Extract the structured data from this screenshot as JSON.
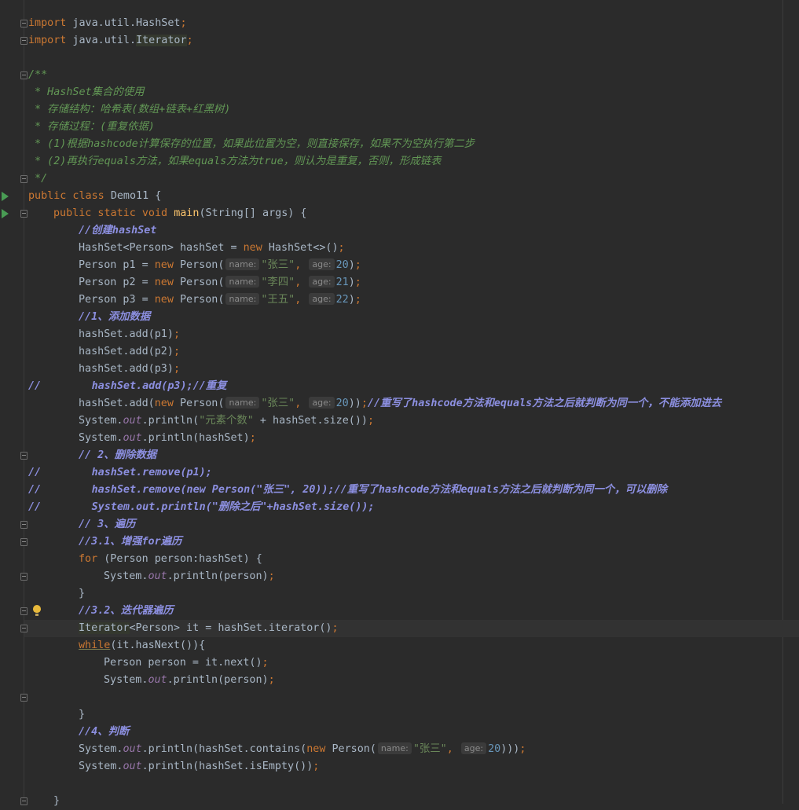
{
  "editor": {
    "language": "java",
    "file_class": "Demo11",
    "lines": [
      {
        "tokens": [
          {
            "t": "import",
            "c": "kw"
          },
          {
            "t": " java.util.HashSet",
            "c": ""
          },
          {
            "t": ";",
            "c": "kw"
          }
        ]
      },
      {
        "tokens": [
          {
            "t": "import",
            "c": "kw"
          },
          {
            "t": " java.util.",
            "c": ""
          },
          {
            "t": "Iterator",
            "c": "import-box"
          },
          {
            "t": ";",
            "c": "kw"
          }
        ]
      },
      {
        "tokens": []
      },
      {
        "tokens": [
          {
            "t": "/**",
            "c": "doc"
          }
        ]
      },
      {
        "tokens": [
          {
            "t": " * HashSet集合的使用",
            "c": "doc"
          }
        ]
      },
      {
        "tokens": [
          {
            "t": " * 存储结构：哈希表(数组+链表+红黑树)",
            "c": "doc"
          }
        ]
      },
      {
        "tokens": [
          {
            "t": " * 存储过程：(重复依据)",
            "c": "doc"
          }
        ]
      },
      {
        "tokens": [
          {
            "t": " * (1)根据hashcode计算保存的位置，如果此位置为空，则直接保存，如果不为空执行第二步",
            "c": "doc"
          }
        ]
      },
      {
        "tokens": [
          {
            "t": " * (2)再执行equals方法，如果equals方法为true，则认为是重复，否则，形成链表",
            "c": "doc"
          }
        ]
      },
      {
        "tokens": [
          {
            "t": " */",
            "c": "doc"
          }
        ]
      },
      {
        "tokens": [
          {
            "t": "public class ",
            "c": "kw"
          },
          {
            "t": "Demo11 {",
            "c": ""
          }
        ]
      },
      {
        "indent": 1,
        "tokens": [
          {
            "t": "public static void ",
            "c": "kw"
          },
          {
            "t": "main",
            "c": "fn"
          },
          {
            "t": "(String[] args) {",
            "c": ""
          }
        ]
      },
      {
        "indent": 2,
        "tokens": [
          {
            "t": "//创建hashSet",
            "c": "cm"
          }
        ]
      },
      {
        "indent": 2,
        "tokens": [
          {
            "t": "HashSet<Person> hashSet = ",
            "c": ""
          },
          {
            "t": "new ",
            "c": "kw"
          },
          {
            "t": "HashSet<>()",
            "c": ""
          },
          {
            "t": ";",
            "c": "kw"
          }
        ]
      },
      {
        "indent": 2,
        "tokens": [
          {
            "t": "Person p1 = ",
            "c": ""
          },
          {
            "t": "new ",
            "c": "kw"
          },
          {
            "t": "Person(",
            "c": ""
          },
          {
            "t": "name:",
            "c": "hint"
          },
          {
            "t": "\"张三\"",
            "c": "str"
          },
          {
            "t": ", ",
            "c": "kw"
          },
          {
            "t": "age:",
            "c": "hint"
          },
          {
            "t": "20",
            "c": "num"
          },
          {
            "t": ")",
            "c": ""
          },
          {
            "t": ";",
            "c": "kw"
          }
        ]
      },
      {
        "indent": 2,
        "tokens": [
          {
            "t": "Person p2 = ",
            "c": ""
          },
          {
            "t": "new ",
            "c": "kw"
          },
          {
            "t": "Person(",
            "c": ""
          },
          {
            "t": "name:",
            "c": "hint"
          },
          {
            "t": "\"李四\"",
            "c": "str"
          },
          {
            "t": ", ",
            "c": "kw"
          },
          {
            "t": "age:",
            "c": "hint"
          },
          {
            "t": "21",
            "c": "num"
          },
          {
            "t": ")",
            "c": ""
          },
          {
            "t": ";",
            "c": "kw"
          }
        ]
      },
      {
        "indent": 2,
        "tokens": [
          {
            "t": "Person p3 = ",
            "c": ""
          },
          {
            "t": "new ",
            "c": "kw"
          },
          {
            "t": "Person(",
            "c": ""
          },
          {
            "t": "name:",
            "c": "hint"
          },
          {
            "t": "\"王五\"",
            "c": "str"
          },
          {
            "t": ", ",
            "c": "kw"
          },
          {
            "t": "age:",
            "c": "hint"
          },
          {
            "t": "22",
            "c": "num"
          },
          {
            "t": ")",
            "c": ""
          },
          {
            "t": ";",
            "c": "kw"
          }
        ]
      },
      {
        "indent": 2,
        "tokens": [
          {
            "t": "//1、添加数据",
            "c": "cm"
          }
        ]
      },
      {
        "indent": 2,
        "tokens": [
          {
            "t": "hashSet.add(p1)",
            "c": ""
          },
          {
            "t": ";",
            "c": "kw"
          }
        ]
      },
      {
        "indent": 2,
        "tokens": [
          {
            "t": "hashSet.add(p2)",
            "c": ""
          },
          {
            "t": ";",
            "c": "kw"
          }
        ]
      },
      {
        "indent": 2,
        "tokens": [
          {
            "t": "hashSet.add(p3)",
            "c": ""
          },
          {
            "t": ";",
            "c": "kw"
          }
        ]
      },
      {
        "tokens": [
          {
            "t": "//        hashSet.add(p3);//重复",
            "c": "cm"
          }
        ]
      },
      {
        "indent": 2,
        "tokens": [
          {
            "t": "hashSet.add(",
            "c": ""
          },
          {
            "t": "new ",
            "c": "kw"
          },
          {
            "t": "Person(",
            "c": ""
          },
          {
            "t": "name:",
            "c": "hint"
          },
          {
            "t": "\"张三\"",
            "c": "str"
          },
          {
            "t": ", ",
            "c": "kw"
          },
          {
            "t": "age:",
            "c": "hint"
          },
          {
            "t": "20",
            "c": "num"
          },
          {
            "t": "))",
            "c": ""
          },
          {
            "t": ";",
            "c": "kw"
          },
          {
            "t": "//重写了hashcode方法和equals方法之后就判断为同一个，不能添加进去",
            "c": "cm"
          }
        ]
      },
      {
        "indent": 2,
        "tokens": [
          {
            "t": "System.",
            "c": ""
          },
          {
            "t": "out",
            "c": "fld"
          },
          {
            "t": ".println(",
            "c": ""
          },
          {
            "t": "\"元素个数\"",
            "c": "str"
          },
          {
            "t": " + hashSet.size())",
            "c": ""
          },
          {
            "t": ";",
            "c": "kw"
          }
        ]
      },
      {
        "indent": 2,
        "tokens": [
          {
            "t": "System.",
            "c": ""
          },
          {
            "t": "out",
            "c": "fld"
          },
          {
            "t": ".println(hashSet)",
            "c": ""
          },
          {
            "t": ";",
            "c": "kw"
          }
        ]
      },
      {
        "indent": 2,
        "tokens": [
          {
            "t": "// 2、删除数据",
            "c": "cm"
          }
        ]
      },
      {
        "tokens": [
          {
            "t": "//        hashSet.remove(p1);",
            "c": "cm"
          }
        ]
      },
      {
        "tokens": [
          {
            "t": "//        hashSet.remove(new Person(\"张三\", 20));//重写了hashcode方法和equals方法之后就判断为同一个，可以删除",
            "c": "cm"
          }
        ]
      },
      {
        "tokens": [
          {
            "t": "//        System.out.println(\"删除之后\"+hashSet.size());",
            "c": "cm"
          }
        ]
      },
      {
        "indent": 2,
        "tokens": [
          {
            "t": "// 3、遍历",
            "c": "cm"
          }
        ]
      },
      {
        "indent": 2,
        "tokens": [
          {
            "t": "//3.1、增强for遍历",
            "c": "cm"
          }
        ]
      },
      {
        "indent": 2,
        "tokens": [
          {
            "t": "for ",
            "c": "kw"
          },
          {
            "t": "(Person person:hashSet) {",
            "c": ""
          }
        ]
      },
      {
        "indent": 3,
        "tokens": [
          {
            "t": "System.",
            "c": ""
          },
          {
            "t": "out",
            "c": "fld"
          },
          {
            "t": ".println(person)",
            "c": ""
          },
          {
            "t": ";",
            "c": "kw"
          }
        ]
      },
      {
        "indent": 2,
        "tokens": [
          {
            "t": "}",
            "c": ""
          }
        ]
      },
      {
        "indent": 2,
        "tokens": [
          {
            "t": "//3.2、迭代器遍历",
            "c": "cm"
          }
        ]
      },
      {
        "indent": 2,
        "tokens": [
          {
            "t": "Iterator",
            "c": "import-box"
          },
          {
            "t": "<Person> it = hashSet.iterator()",
            "c": ""
          },
          {
            "t": ";",
            "c": "kw"
          }
        ]
      },
      {
        "indent": 2,
        "tokens": [
          {
            "t": "while",
            "c": "kw ulw"
          },
          {
            "t": "(it.hasNext()){",
            "c": ""
          }
        ]
      },
      {
        "indent": 3,
        "tokens": [
          {
            "t": "Person person = it.next()",
            "c": ""
          },
          {
            "t": ";",
            "c": "kw"
          }
        ]
      },
      {
        "indent": 3,
        "tokens": [
          {
            "t": "System.",
            "c": ""
          },
          {
            "t": "out",
            "c": "fld"
          },
          {
            "t": ".println(person)",
            "c": ""
          },
          {
            "t": ";",
            "c": "kw"
          }
        ]
      },
      {
        "tokens": []
      },
      {
        "indent": 2,
        "tokens": [
          {
            "t": "}",
            "c": ""
          }
        ]
      },
      {
        "indent": 2,
        "tokens": [
          {
            "t": "//4、判断",
            "c": "cm"
          }
        ]
      },
      {
        "indent": 2,
        "tokens": [
          {
            "t": "System.",
            "c": ""
          },
          {
            "t": "out",
            "c": "fld"
          },
          {
            "t": ".println(hashSet.contains(",
            "c": ""
          },
          {
            "t": "new ",
            "c": "kw"
          },
          {
            "t": "Person(",
            "c": ""
          },
          {
            "t": "name:",
            "c": "hint"
          },
          {
            "t": "\"张三\"",
            "c": "str"
          },
          {
            "t": ", ",
            "c": "kw"
          },
          {
            "t": "age:",
            "c": "hint"
          },
          {
            "t": "20",
            "c": "num"
          },
          {
            "t": ")))",
            "c": ""
          },
          {
            "t": ";",
            "c": "kw"
          }
        ]
      },
      {
        "indent": 2,
        "tokens": [
          {
            "t": "System.",
            "c": ""
          },
          {
            "t": "out",
            "c": "fld"
          },
          {
            "t": ".println(hashSet.isEmpty())",
            "c": ""
          },
          {
            "t": ";",
            "c": "kw"
          }
        ]
      },
      {
        "tokens": []
      },
      {
        "indent": 1,
        "tokens": [
          {
            "t": "}",
            "c": ""
          }
        ]
      }
    ],
    "gutter": {
      "run_lines": [
        10,
        11
      ],
      "fold_lines": [
        0,
        1,
        3,
        9,
        11,
        25,
        29,
        30,
        32,
        34,
        35,
        39,
        45
      ],
      "bulb_line": 34,
      "current_line": 34
    },
    "colors": {
      "background": "#2b2b2b",
      "keyword": "#cc7832",
      "string": "#6a8759",
      "number": "#6897bb",
      "doc_comment": "#629755",
      "line_comment": "#8c8fe0",
      "static_field": "#9876aa",
      "method_decl": "#ffc66d",
      "run_icon": "#499c54",
      "bulb_icon": "#e8b93b"
    }
  }
}
